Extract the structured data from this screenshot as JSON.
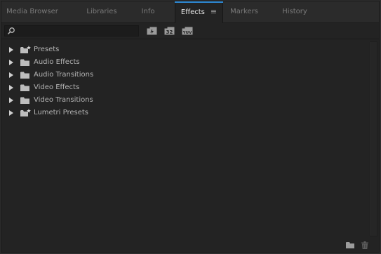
{
  "tabs": [
    {
      "label": "Media Browser"
    },
    {
      "label": "Libraries"
    },
    {
      "label": "Info"
    },
    {
      "label": "Effects",
      "menu_glyph": "≡"
    },
    {
      "label": "Markers"
    },
    {
      "label": "History"
    }
  ],
  "active_tab": "Effects",
  "search": {
    "value": "",
    "placeholder": ""
  },
  "filters": [
    {
      "icon": "accelerated-effects-icon",
      "text": ""
    },
    {
      "icon": "32-bit-color-icon",
      "text": "32"
    },
    {
      "icon": "yuv-effects-icon",
      "text": "YUV"
    }
  ],
  "tree": [
    {
      "label": "Presets",
      "icon": "preset-folder-icon"
    },
    {
      "label": "Audio Effects",
      "icon": "folder-icon"
    },
    {
      "label": "Audio Transitions",
      "icon": "folder-icon"
    },
    {
      "label": "Video Effects",
      "icon": "folder-icon"
    },
    {
      "label": "Video Transitions",
      "icon": "folder-icon"
    },
    {
      "label": "Lumetri Presets",
      "icon": "preset-folder-icon"
    }
  ],
  "footer": {
    "new_bin_icon": "new-custom-bin-icon",
    "delete_icon": "trash-icon"
  },
  "colors": {
    "panel_bg": "#232323",
    "tabbar_bg": "#2b2b2b",
    "active_tab_accent": "#2f8bd6",
    "text": "#b4b4b4"
  }
}
